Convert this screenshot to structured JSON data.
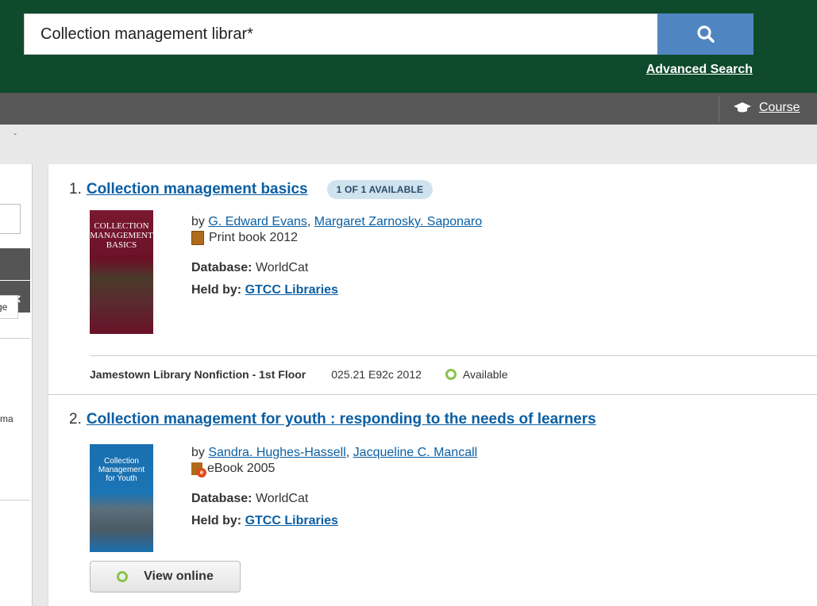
{
  "search": {
    "query": "Collection management librar*",
    "advanced_label": "Advanced Search"
  },
  "nav": {
    "course_label": "Course"
  },
  "sidebar": {
    "tab_text": "ge",
    "text2": "rma"
  },
  "results": [
    {
      "number": "1.",
      "title": "Collection management basics",
      "availability": "1 OF 1 AVAILABLE",
      "by_prefix": "by",
      "authors": [
        "G. Edward Evans",
        "Margaret Zarnosky. Saponaro"
      ],
      "format": "Print book 2012",
      "format_icon": "print-book-icon",
      "database_label": "Database:",
      "database": "WorldCat",
      "held_label": "Held by:",
      "held_by": "GTCC Libraries",
      "cover_title": "COLLECTION MANAGEMENT BASICS",
      "holding": {
        "location": "Jamestown Library Nonfiction - 1st Floor",
        "call_number": "025.21 E92c 2012",
        "status": "Available"
      }
    },
    {
      "number": "2.",
      "title": "Collection management for youth : responding to the needs of learners",
      "by_prefix": "by",
      "authors": [
        "Sandra. Hughes-Hassell",
        "Jacqueline C. Mancall"
      ],
      "format": "eBook 2005",
      "format_icon": "ebook-icon",
      "database_label": "Database:",
      "database": "WorldCat",
      "held_label": "Held by:",
      "held_by": "GTCC Libraries",
      "cover_title": "Collection Management for Youth",
      "view_online_label": "View online"
    }
  ],
  "colors": {
    "header_bg": "#0e4a2b",
    "nav_bg": "#575757",
    "search_button": "#4f86c2",
    "link": "#0b5fa3",
    "available_green": "#8bc34a",
    "badge_bg": "#cfe3ee"
  }
}
